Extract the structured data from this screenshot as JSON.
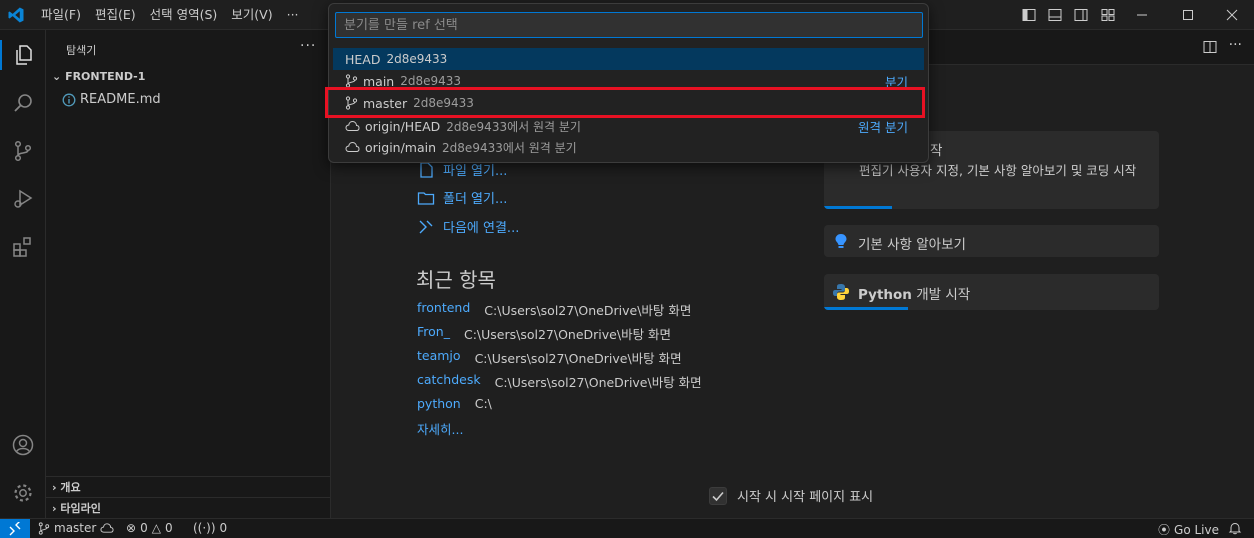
{
  "menu": {
    "items": [
      "파일(F)",
      "편집(E)",
      "선택 영역(S)",
      "보기(V)"
    ],
    "more": "···"
  },
  "sidebar": {
    "title": "탐색기",
    "more": "···",
    "folder": "FRONTEND-1",
    "files": [
      "README.md"
    ],
    "sections": [
      "개요",
      "타임라인"
    ]
  },
  "editor": {
    "tab_more": "···",
    "start_links": [
      "파일 열기...",
      "폴더 열기...",
      "다음에 연결..."
    ],
    "recent_title": "최근 항목",
    "recent": [
      {
        "name": "frontend",
        "path": "C:\\Users\\sol27\\OneDrive\\바탕 화면"
      },
      {
        "name": "Fron_",
        "path": "C:\\Users\\sol27\\OneDrive\\바탕 화면"
      },
      {
        "name": "teamjo",
        "path": "C:\\Users\\sol27\\OneDrive\\바탕 화면"
      },
      {
        "name": "catchdesk",
        "path": "C:\\Users\\sol27\\OneDrive\\바탕 화면"
      },
      {
        "name": "python",
        "path": "C:\\"
      }
    ],
    "more_link": "자세히...",
    "walkthroughs": {
      "card1_title_tail": "작",
      "card1_desc": "편집기 사용자 지정, 기본 사항 알아보기 및 코딩 시작",
      "card2_title": "기본 사항 알아보기",
      "card3_title_bold": "Python",
      "card3_title_rest": " 개발 시작"
    },
    "startup_checkbox": "시작 시 시작 페이지 표시",
    "startup_checked": true
  },
  "quickpick": {
    "placeholder": "분기를 만들 ref 선택",
    "items": [
      {
        "label": "HEAD",
        "desc": "2d8e9433",
        "icon": "none",
        "active": true
      },
      {
        "label": "main",
        "desc": "2d8e9433",
        "icon": "branch-icon",
        "separator": "분기"
      },
      {
        "label": "master",
        "desc": "2d8e9433",
        "icon": "branch-icon",
        "highlighted": true
      },
      {
        "label": "origin/HEAD",
        "desc": "2d8e9433에서 원격 분기",
        "icon": "cloud-icon",
        "separator": "원격 분기"
      },
      {
        "label": "origin/main",
        "desc": "2d8e9433에서 원격 분기",
        "icon": "cloud-icon"
      }
    ]
  },
  "statusbar": {
    "branch": "master",
    "errors": "0",
    "warnings": "0",
    "ports": "0",
    "golive": "Go Live"
  },
  "colors": {
    "accent": "#0078d4",
    "link": "#4daafc",
    "highlight_box": "#e81123",
    "list_active": "#04395e"
  }
}
